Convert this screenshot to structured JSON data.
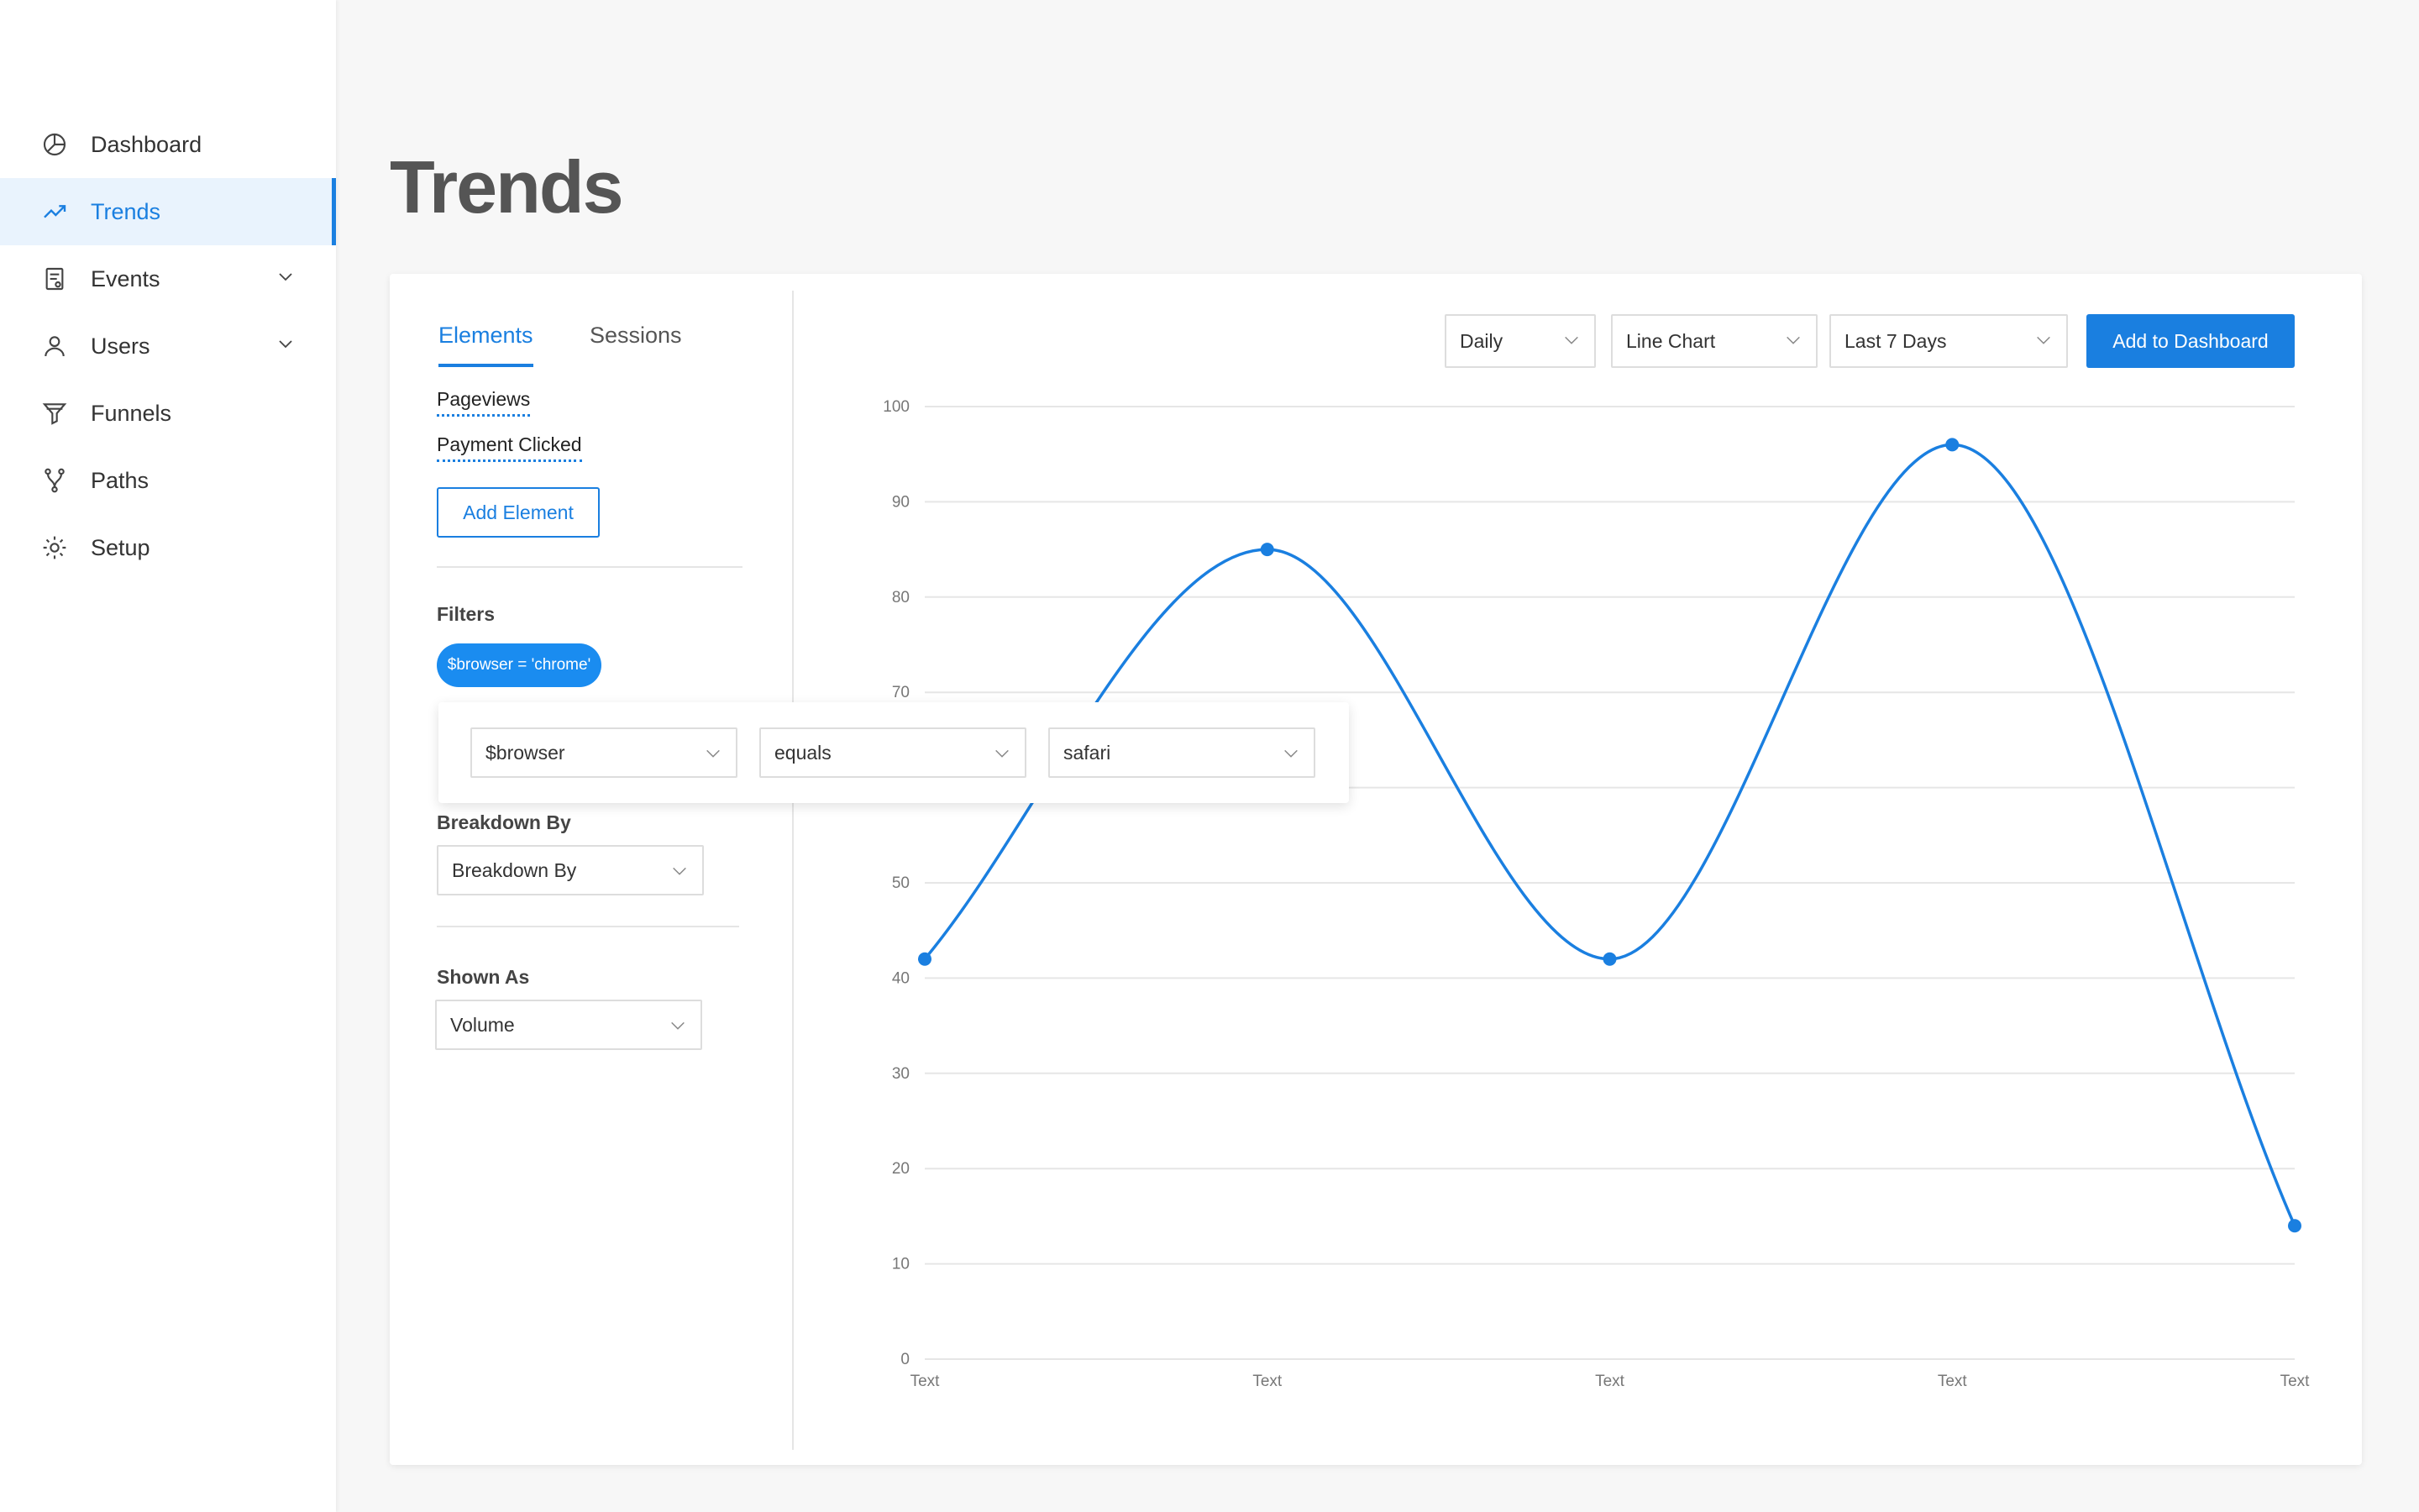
{
  "sidebar": {
    "items": [
      {
        "label": "Dashboard",
        "icon": "pie-chart-icon",
        "active": false
      },
      {
        "label": "Trends",
        "icon": "trend-line-icon",
        "active": true
      },
      {
        "label": "Events",
        "icon": "events-doc-icon",
        "active": false,
        "expandable": true
      },
      {
        "label": "Users",
        "icon": "user-icon",
        "active": false,
        "expandable": true
      },
      {
        "label": "Funnels",
        "icon": "funnel-icon",
        "active": false
      },
      {
        "label": "Paths",
        "icon": "paths-fork-icon",
        "active": false
      },
      {
        "label": "Setup",
        "icon": "gear-icon",
        "active": false
      }
    ]
  },
  "page": {
    "title": "Trends"
  },
  "panel": {
    "tabs": [
      {
        "label": "Elements",
        "active": true
      },
      {
        "label": "Sessions",
        "active": false
      }
    ],
    "elements": [
      "Pageviews",
      "Payment Clicked"
    ],
    "add_element_label": "Add Element",
    "filters_label": "Filters",
    "filter_pill": "$browser = 'chrome'",
    "filter_editor": {
      "property": "$browser",
      "operator": "equals",
      "value": "safari"
    },
    "breakdown_label": "Breakdown By",
    "breakdown_value": "Breakdown By",
    "shown_as_label": "Shown As",
    "shown_as_value": "Volume"
  },
  "toolbar": {
    "interval": "Daily",
    "chart_type": "Line Chart",
    "date_range": "Last 7 Days",
    "add_to_dashboard": "Add to Dashboard"
  },
  "colors": {
    "accent": "#1a7fe0",
    "line": "#1a7fe0",
    "pill": "#1a8cf0"
  },
  "chart_data": {
    "type": "line",
    "categories": [
      "Text",
      "Text",
      "Text",
      "Text",
      "Text"
    ],
    "series": [
      {
        "values": [
          42,
          85,
          42,
          96,
          14
        ]
      }
    ],
    "yticks": [
      0,
      10,
      20,
      30,
      40,
      50,
      60,
      70,
      80,
      90,
      100
    ],
    "ylim": [
      0,
      100
    ],
    "grid": true,
    "smooth": true
  }
}
